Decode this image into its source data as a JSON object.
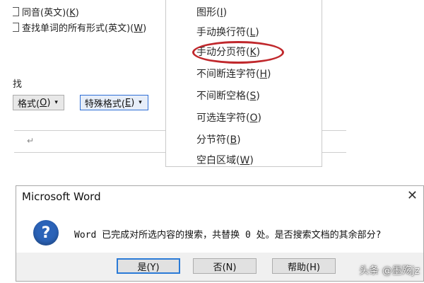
{
  "find_dialog": {
    "options": [
      {
        "label": "同音(英文)(",
        "key": "K",
        "suffix": ")"
      },
      {
        "label": "查找单词的所有形式(英文)(",
        "key": "W",
        "suffix": ")"
      }
    ],
    "section_label": "找",
    "format_button": {
      "label": "格式(",
      "key": "O",
      "suffix": ")",
      "caret": "▾"
    },
    "special_button": {
      "label": "特殊格式(",
      "key": "E",
      "suffix": ")",
      "caret": "▾"
    }
  },
  "document": {
    "paragraph_mark": "↵"
  },
  "menu": {
    "items": [
      {
        "label": "图形(",
        "key": "I",
        "suffix": ")"
      },
      {
        "label": "手动换行符(",
        "key": "L",
        "suffix": ")"
      },
      {
        "label": "手动分页符(",
        "key": "K",
        "suffix": ")",
        "highlighted": true
      },
      {
        "label": "不间断连字符(",
        "key": "H",
        "suffix": ")"
      },
      {
        "label": "不间断空格(",
        "key": "S",
        "suffix": ")"
      },
      {
        "label": "可选连字符(",
        "key": "O",
        "suffix": ")"
      },
      {
        "label": "分节符(",
        "key": "B",
        "suffix": ")"
      },
      {
        "label": "空白区域(",
        "key": "W",
        "suffix": ")"
      }
    ],
    "highlight_color": "#c0282c"
  },
  "message_box": {
    "title": "Microsoft Word",
    "close_glyph": "✕",
    "icon": "question-icon",
    "icon_glyph": "?",
    "message": "Word 已完成对所选内容的搜索，共替换 0 处。是否搜索文档的其余部分?",
    "buttons": {
      "yes": "是(Y)",
      "no": "否(N)",
      "help": "帮助(H)"
    },
    "accent_color": "#2a7ad6"
  },
  "watermark": "头条 @墨殇jz"
}
